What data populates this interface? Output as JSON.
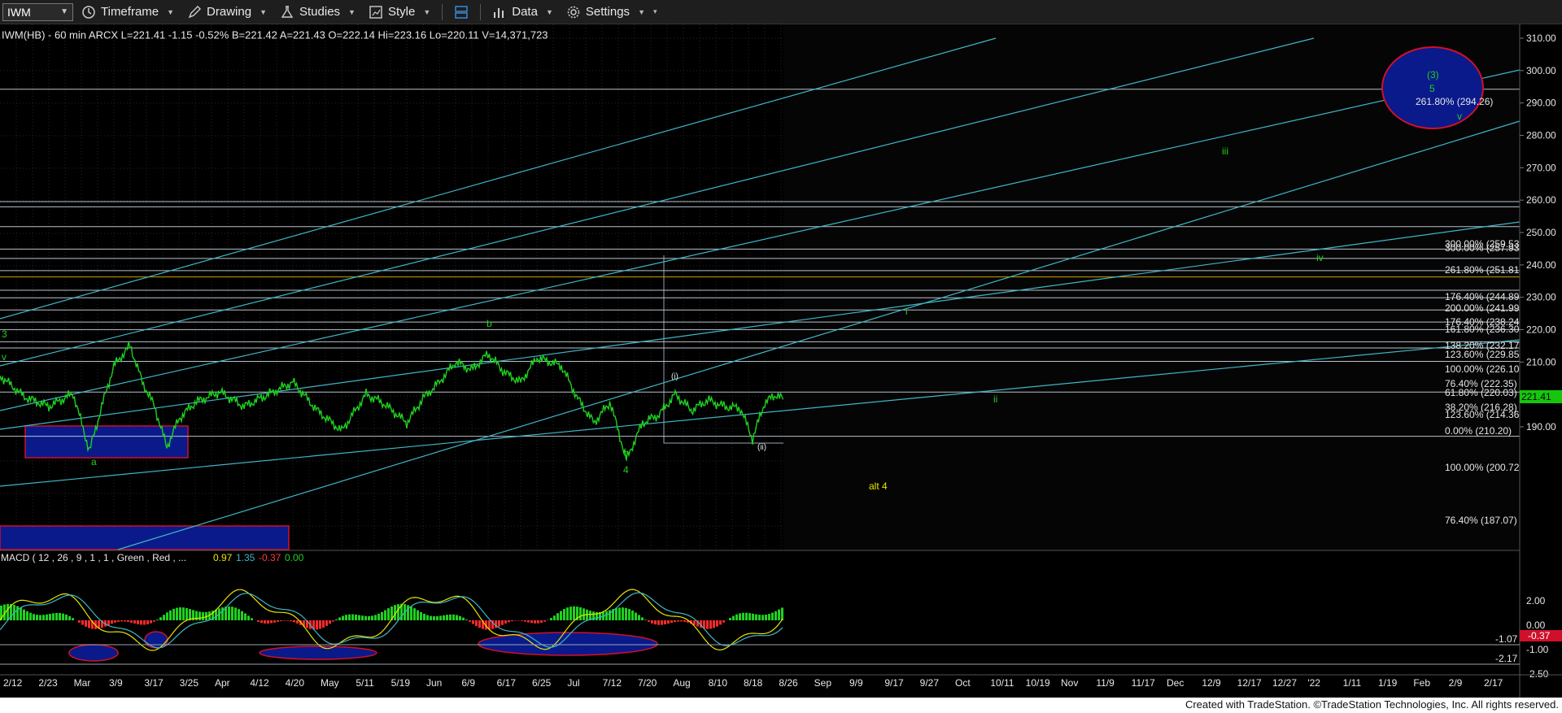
{
  "toolbar": {
    "symbol": "IWM",
    "items": [
      {
        "label": "Timeframe",
        "icon": "clock-icon"
      },
      {
        "label": "Drawing",
        "icon": "pencil-icon"
      },
      {
        "label": "Studies",
        "icon": "flask-icon"
      },
      {
        "label": "Style",
        "icon": "style-icon"
      },
      {
        "label": "",
        "icon": "layout-icon"
      },
      {
        "label": "Data",
        "icon": "bar-chart-icon"
      },
      {
        "label": "Settings",
        "icon": "gear-icon"
      }
    ]
  },
  "header": {
    "text": "IWM(HB) - 60 min  ARCX  L=221.41 -1.15 -0.52% B=221.42 A=221.43 O=222.14 Hi=223.16 Lo=220.11 V=14,371,723"
  },
  "price_axis": {
    "ticks": [
      "310.00",
      "300.00",
      "290.00",
      "280.00",
      "270.00",
      "260.00",
      "250.00",
      "240.00",
      "230.00",
      "220.00",
      "210.00",
      "200.00",
      "190.00"
    ],
    "last_price": "221.41",
    "last_price_color": "#16c60c"
  },
  "macd": {
    "header": "MACD ( 12 , 26 , 9 , 1 , 1 , Green , Red , ...",
    "values": [
      "0.97",
      "1.35",
      "-0.37",
      "0.00"
    ],
    "axis_ticks": [
      "2.00",
      "0.00",
      "-1.00",
      "-2.50"
    ],
    "level_labels": [
      "-1.07",
      "-2.17"
    ],
    "last_value": "-0.37"
  },
  "time_axis": {
    "labels": [
      "2/12",
      "2/23",
      "Mar",
      "3/9",
      "3/17",
      "3/25",
      "Apr",
      "4/12",
      "4/20",
      "May",
      "5/11",
      "5/19",
      "Jun",
      "6/9",
      "6/17",
      "6/25",
      "Jul",
      "7/12",
      "7/20",
      "Aug",
      "8/10",
      "8/18",
      "8/26",
      "Sep",
      "9/9",
      "9/17",
      "9/27",
      "Oct",
      "10/11",
      "10/19",
      "Nov",
      "11/9",
      "11/17",
      "Dec",
      "12/9",
      "12/17",
      "12/27",
      "'22",
      "1/11",
      "1/19",
      "Feb",
      "2/9",
      "2/17"
    ]
  },
  "fib_labels": [
    "300.00% (259.53)",
    "300.00% (257.93)",
    "261.80% (251.81)",
    "176.40% (244.89)",
    "200.00% (241.99)",
    "176.40% (238.24)",
    "161.80% (236.30)",
    "138.20% (232.17)",
    "123.60% (229.85)",
    "100.00% (226.10)",
    "76.40% (222.35)",
    "61.80% (220.03)",
    "38.20% (216.28)",
    "123.60% (214.36)",
    "0.00% (210.20)",
    "100.00% (200.72)",
    "76.40% (187.07)",
    "261.80% (294.26)"
  ],
  "wave_labels": {
    "green": [
      "3",
      "v",
      "b",
      "i",
      "ii",
      "iii",
      "iv",
      "(3)",
      "5",
      "v",
      "c",
      "4",
      "a"
    ],
    "white": [
      "(i)",
      "(ii)"
    ],
    "yellow": [
      "alt 4"
    ]
  },
  "footer": "Created with TradeStation. ©TradeStation Technologies, Inc. All rights reserved.",
  "colors": {
    "channel": "#3fb6c6",
    "fib_line": "#b8c2cc",
    "price": "#1fd11f",
    "target_fill": "#0a1a8a",
    "target_edge": "#d0102a"
  }
}
